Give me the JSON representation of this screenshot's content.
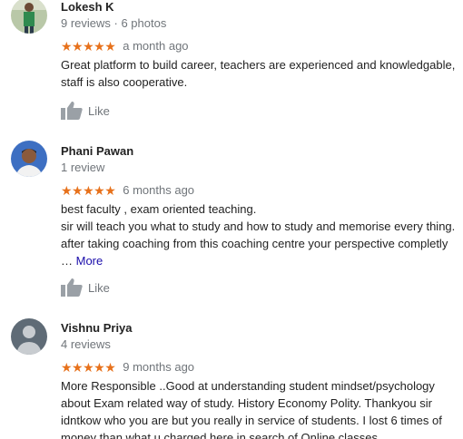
{
  "reviews": [
    {
      "name": "Lokesh K",
      "meta": "9 reviews · 6 photos",
      "stars": "★★★★★",
      "rating": 5,
      "time": "a month ago",
      "lines": [
        "Great platform to build career, teachers are experienced and knowledgable,",
        "staff is also cooperative."
      ],
      "like_label": "Like"
    },
    {
      "name": "Phani Pawan",
      "meta": "1 review",
      "stars": "★★★★★",
      "rating": 5,
      "time": "6 months ago",
      "lines": [
        "best faculty , exam oriented teaching.",
        "sir will teach you what to study and how to study and memorise every thing.",
        "after taking coaching from this coaching centre your perspective completly"
      ],
      "more_prefix": "… ",
      "more_label": "More",
      "like_label": "Like"
    },
    {
      "name": "Vishnu Priya",
      "meta": "4 reviews",
      "stars": "★★★★★",
      "rating": 5,
      "time": "9 months ago",
      "lines": [
        "More Responsible ..Good at understanding student mindset/psychology",
        "about Exam related way of study. History Economy Polity. Thankyou sir",
        "idntkow who you are but you really in service of students. I lost 6 times of",
        "money than what u charged here in search of Online classes."
      ]
    }
  ],
  "colors": {
    "star": "#e7711b",
    "meta": "#70757a",
    "link": "#1a0dab"
  }
}
